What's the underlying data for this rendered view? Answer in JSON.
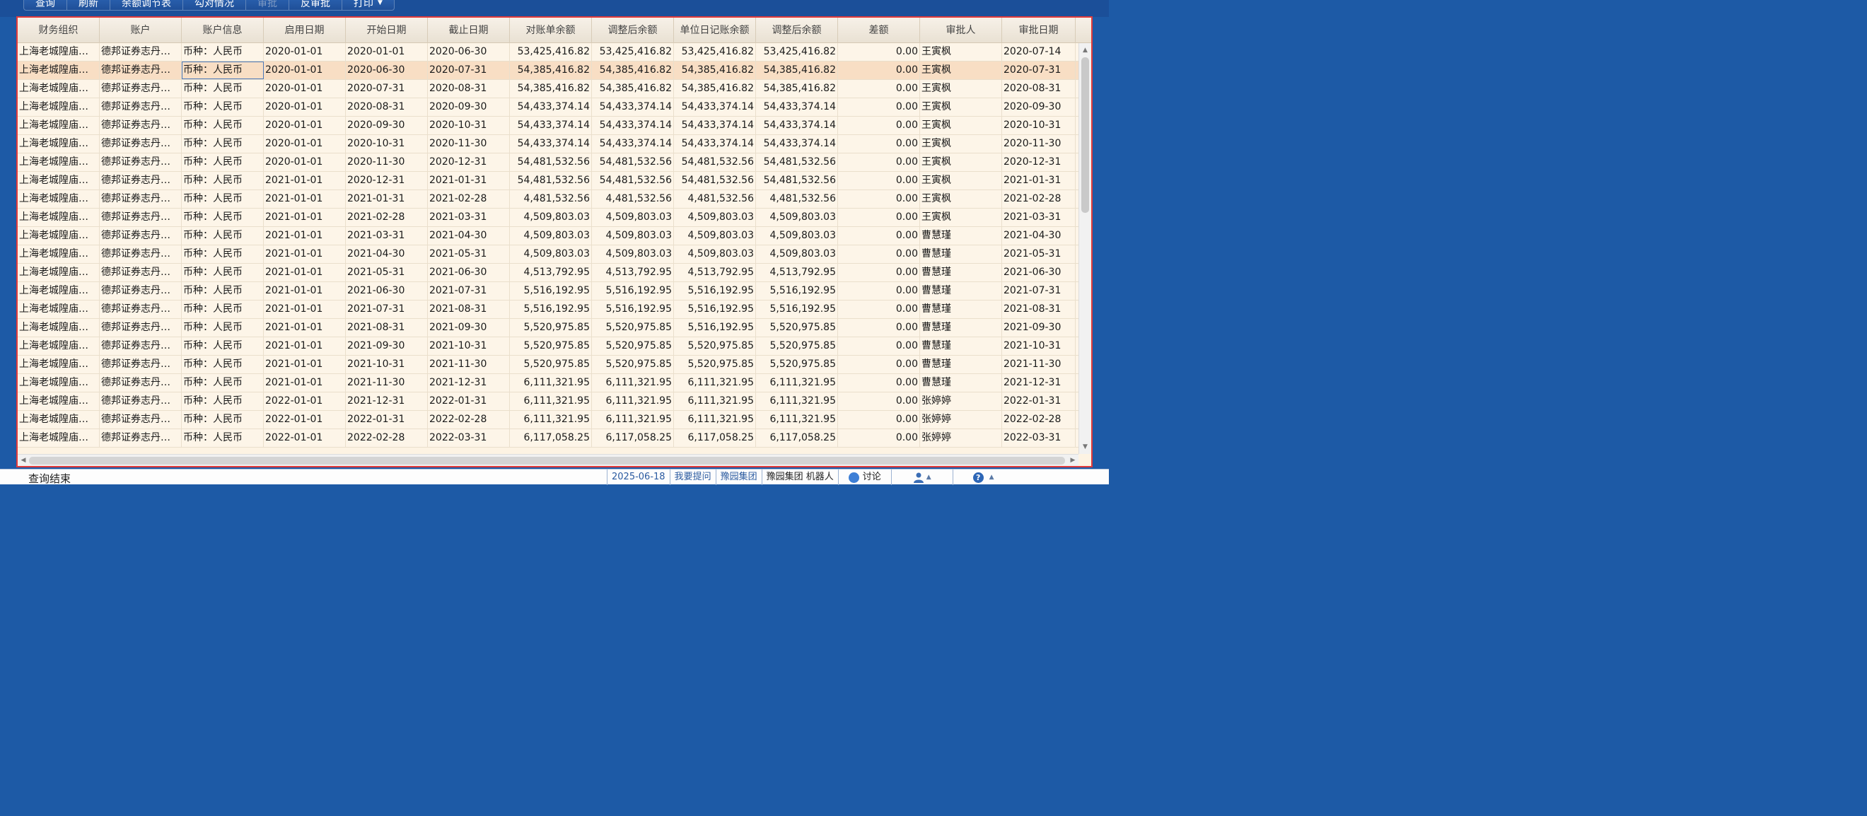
{
  "toolbar": {
    "buttons": [
      "查询",
      "刷新",
      "余额调节表",
      "勾对情况",
      "审批",
      "反审批",
      "打印"
    ]
  },
  "grid": {
    "columns": [
      "财务组织",
      "账户",
      "账户信息",
      "启用日期",
      "开始日期",
      "截止日期",
      "对账单余额",
      "调整后余额",
      "单位日记账余额",
      "调整后余额",
      "差额",
      "审批人",
      "审批日期"
    ],
    "rows": [
      [
        "上海老城隍庙餐...",
        "德邦证券志丹路...",
        "币种：人民币",
        "2020-01-01",
        "2020-01-01",
        "2020-06-30",
        "53,425,416.82",
        "53,425,416.82",
        "53,425,416.82",
        "53,425,416.82",
        "0.00",
        "王寅枫",
        "2020-07-14"
      ],
      [
        "上海老城隍庙餐...",
        "德邦证券志丹路...",
        "币种：人民币",
        "2020-01-01",
        "2020-06-30",
        "2020-07-31",
        "54,385,416.82",
        "54,385,416.82",
        "54,385,416.82",
        "54,385,416.82",
        "0.00",
        "王寅枫",
        "2020-07-31"
      ],
      [
        "上海老城隍庙餐...",
        "德邦证券志丹路...",
        "币种：人民币",
        "2020-01-01",
        "2020-07-31",
        "2020-08-31",
        "54,385,416.82",
        "54,385,416.82",
        "54,385,416.82",
        "54,385,416.82",
        "0.00",
        "王寅枫",
        "2020-08-31"
      ],
      [
        "上海老城隍庙餐...",
        "德邦证券志丹路...",
        "币种：人民币",
        "2020-01-01",
        "2020-08-31",
        "2020-09-30",
        "54,433,374.14",
        "54,433,374.14",
        "54,433,374.14",
        "54,433,374.14",
        "0.00",
        "王寅枫",
        "2020-09-30"
      ],
      [
        "上海老城隍庙餐...",
        "德邦证券志丹路...",
        "币种：人民币",
        "2020-01-01",
        "2020-09-30",
        "2020-10-31",
        "54,433,374.14",
        "54,433,374.14",
        "54,433,374.14",
        "54,433,374.14",
        "0.00",
        "王寅枫",
        "2020-10-31"
      ],
      [
        "上海老城隍庙餐...",
        "德邦证券志丹路...",
        "币种：人民币",
        "2020-01-01",
        "2020-10-31",
        "2020-11-30",
        "54,433,374.14",
        "54,433,374.14",
        "54,433,374.14",
        "54,433,374.14",
        "0.00",
        "王寅枫",
        "2020-11-30"
      ],
      [
        "上海老城隍庙餐...",
        "德邦证券志丹路...",
        "币种：人民币",
        "2020-01-01",
        "2020-11-30",
        "2020-12-31",
        "54,481,532.56",
        "54,481,532.56",
        "54,481,532.56",
        "54,481,532.56",
        "0.00",
        "王寅枫",
        "2020-12-31"
      ],
      [
        "上海老城隍庙餐...",
        "德邦证券志丹路...",
        "币种：人民币",
        "2021-01-01",
        "2020-12-31",
        "2021-01-31",
        "54,481,532.56",
        "54,481,532.56",
        "54,481,532.56",
        "54,481,532.56",
        "0.00",
        "王寅枫",
        "2021-01-31"
      ],
      [
        "上海老城隍庙餐...",
        "德邦证券志丹路...",
        "币种：人民币",
        "2021-01-01",
        "2021-01-31",
        "2021-02-28",
        "4,481,532.56",
        "4,481,532.56",
        "4,481,532.56",
        "4,481,532.56",
        "0.00",
        "王寅枫",
        "2021-02-28"
      ],
      [
        "上海老城隍庙餐...",
        "德邦证券志丹路...",
        "币种：人民币",
        "2021-01-01",
        "2021-02-28",
        "2021-03-31",
        "4,509,803.03",
        "4,509,803.03",
        "4,509,803.03",
        "4,509,803.03",
        "0.00",
        "王寅枫",
        "2021-03-31"
      ],
      [
        "上海老城隍庙餐...",
        "德邦证券志丹路...",
        "币种：人民币",
        "2021-01-01",
        "2021-03-31",
        "2021-04-30",
        "4,509,803.03",
        "4,509,803.03",
        "4,509,803.03",
        "4,509,803.03",
        "0.00",
        "曹慧瑾",
        "2021-04-30"
      ],
      [
        "上海老城隍庙餐...",
        "德邦证券志丹路...",
        "币种：人民币",
        "2021-01-01",
        "2021-04-30",
        "2021-05-31",
        "4,509,803.03",
        "4,509,803.03",
        "4,509,803.03",
        "4,509,803.03",
        "0.00",
        "曹慧瑾",
        "2021-05-31"
      ],
      [
        "上海老城隍庙餐...",
        "德邦证券志丹路...",
        "币种：人民币",
        "2021-01-01",
        "2021-05-31",
        "2021-06-30",
        "4,513,792.95",
        "4,513,792.95",
        "4,513,792.95",
        "4,513,792.95",
        "0.00",
        "曹慧瑾",
        "2021-06-30"
      ],
      [
        "上海老城隍庙餐...",
        "德邦证券志丹路...",
        "币种：人民币",
        "2021-01-01",
        "2021-06-30",
        "2021-07-31",
        "5,516,192.95",
        "5,516,192.95",
        "5,516,192.95",
        "5,516,192.95",
        "0.00",
        "曹慧瑾",
        "2021-07-31"
      ],
      [
        "上海老城隍庙餐...",
        "德邦证券志丹路...",
        "币种：人民币",
        "2021-01-01",
        "2021-07-31",
        "2021-08-31",
        "5,516,192.95",
        "5,516,192.95",
        "5,516,192.95",
        "5,516,192.95",
        "0.00",
        "曹慧瑾",
        "2021-08-31"
      ],
      [
        "上海老城隍庙餐...",
        "德邦证券志丹路...",
        "币种：人民币",
        "2021-01-01",
        "2021-08-31",
        "2021-09-30",
        "5,520,975.85",
        "5,520,975.85",
        "5,516,192.95",
        "5,520,975.85",
        "0.00",
        "曹慧瑾",
        "2021-09-30"
      ],
      [
        "上海老城隍庙餐...",
        "德邦证券志丹路...",
        "币种：人民币",
        "2021-01-01",
        "2021-09-30",
        "2021-10-31",
        "5,520,975.85",
        "5,520,975.85",
        "5,520,975.85",
        "5,520,975.85",
        "0.00",
        "曹慧瑾",
        "2021-10-31"
      ],
      [
        "上海老城隍庙餐...",
        "德邦证券志丹路...",
        "币种：人民币",
        "2021-01-01",
        "2021-10-31",
        "2021-11-30",
        "5,520,975.85",
        "5,520,975.85",
        "5,520,975.85",
        "5,520,975.85",
        "0.00",
        "曹慧瑾",
        "2021-11-30"
      ],
      [
        "上海老城隍庙餐...",
        "德邦证券志丹路...",
        "币种：人民币",
        "2021-01-01",
        "2021-11-30",
        "2021-12-31",
        "6,111,321.95",
        "6,111,321.95",
        "6,111,321.95",
        "6,111,321.95",
        "0.00",
        "曹慧瑾",
        "2021-12-31"
      ],
      [
        "上海老城隍庙餐...",
        "德邦证券志丹路...",
        "币种：人民币",
        "2022-01-01",
        "2021-12-31",
        "2022-01-31",
        "6,111,321.95",
        "6,111,321.95",
        "6,111,321.95",
        "6,111,321.95",
        "0.00",
        "张婷婷",
        "2022-01-31"
      ],
      [
        "上海老城隍庙餐...",
        "德邦证券志丹路...",
        "币种：人民币",
        "2022-01-01",
        "2022-01-31",
        "2022-02-28",
        "6,111,321.95",
        "6,111,321.95",
        "6,111,321.95",
        "6,111,321.95",
        "0.00",
        "张婷婷",
        "2022-02-28"
      ],
      [
        "上海老城隍庙餐...",
        "德邦证券志丹路...",
        "币种：人民币",
        "2022-01-01",
        "2022-02-28",
        "2022-03-31",
        "6,117,058.25",
        "6,117,058.25",
        "6,117,058.25",
        "6,117,058.25",
        "0.00",
        "张婷婷",
        "2022-03-31"
      ]
    ],
    "selected_row": 1
  },
  "status": {
    "text": "查询结束",
    "date": "2025-06-18",
    "ask": "我要提问",
    "group": "豫园集团",
    "robot": "豫园集团 机器人",
    "discuss": "讨论"
  },
  "colors": {
    "toolbar_bg": "#1b4f99",
    "panel_border": "#e23b3b",
    "row_bg": "#fdf5e8",
    "selected_row_bg": "#f8dec4"
  }
}
